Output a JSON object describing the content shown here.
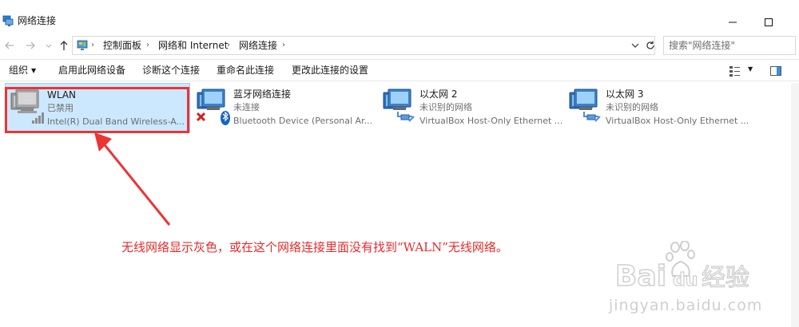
{
  "window": {
    "title": "网络连接",
    "minimize_icon": "minimize-icon",
    "maximize_icon": "maximize-icon"
  },
  "address": {
    "breadcrumbs": [
      "控制面板",
      "网络和 Internet",
      "网络连接"
    ],
    "search_placeholder": "搜索\"网络连接\""
  },
  "toolbar": {
    "organize": "组织",
    "enable": "启用此网络设备",
    "diagnose": "诊断这个连接",
    "rename": "重命名此连接",
    "change_settings": "更改此连接的设置"
  },
  "connections": [
    {
      "name": "WLAN",
      "status": "已禁用",
      "device": "Intel(R) Dual Band Wireless-A...",
      "icon": "wireless-adapter-icon",
      "selected": true
    },
    {
      "name": "蓝牙网络连接",
      "status": "未连接",
      "device": "Bluetooth Device (Personal Ar...",
      "icon": "bluetooth-adapter-icon",
      "selected": false
    },
    {
      "name": "以太网 2",
      "status": "未识别的网络",
      "device": "VirtualBox Host-Only Ethernet ...",
      "icon": "ethernet-adapter-icon",
      "selected": false
    },
    {
      "name": "以太网 3",
      "status": "未识别的网络",
      "device": "VirtualBox Host-Only Ethernet ...",
      "icon": "ethernet-adapter-icon",
      "selected": false
    }
  ],
  "annotation": {
    "text": "无线网络显示灰色，或在这个网络连接里面没有找到“WALN”无线网络。",
    "color": "#e52b2b"
  },
  "watermark": {
    "logo": "Bai du 经验",
    "url": "jingyan.baidu.com"
  },
  "colors": {
    "selection_bg": "#cce8ff",
    "selection_border": "#99d1ff",
    "highlight": "#ee3333"
  }
}
